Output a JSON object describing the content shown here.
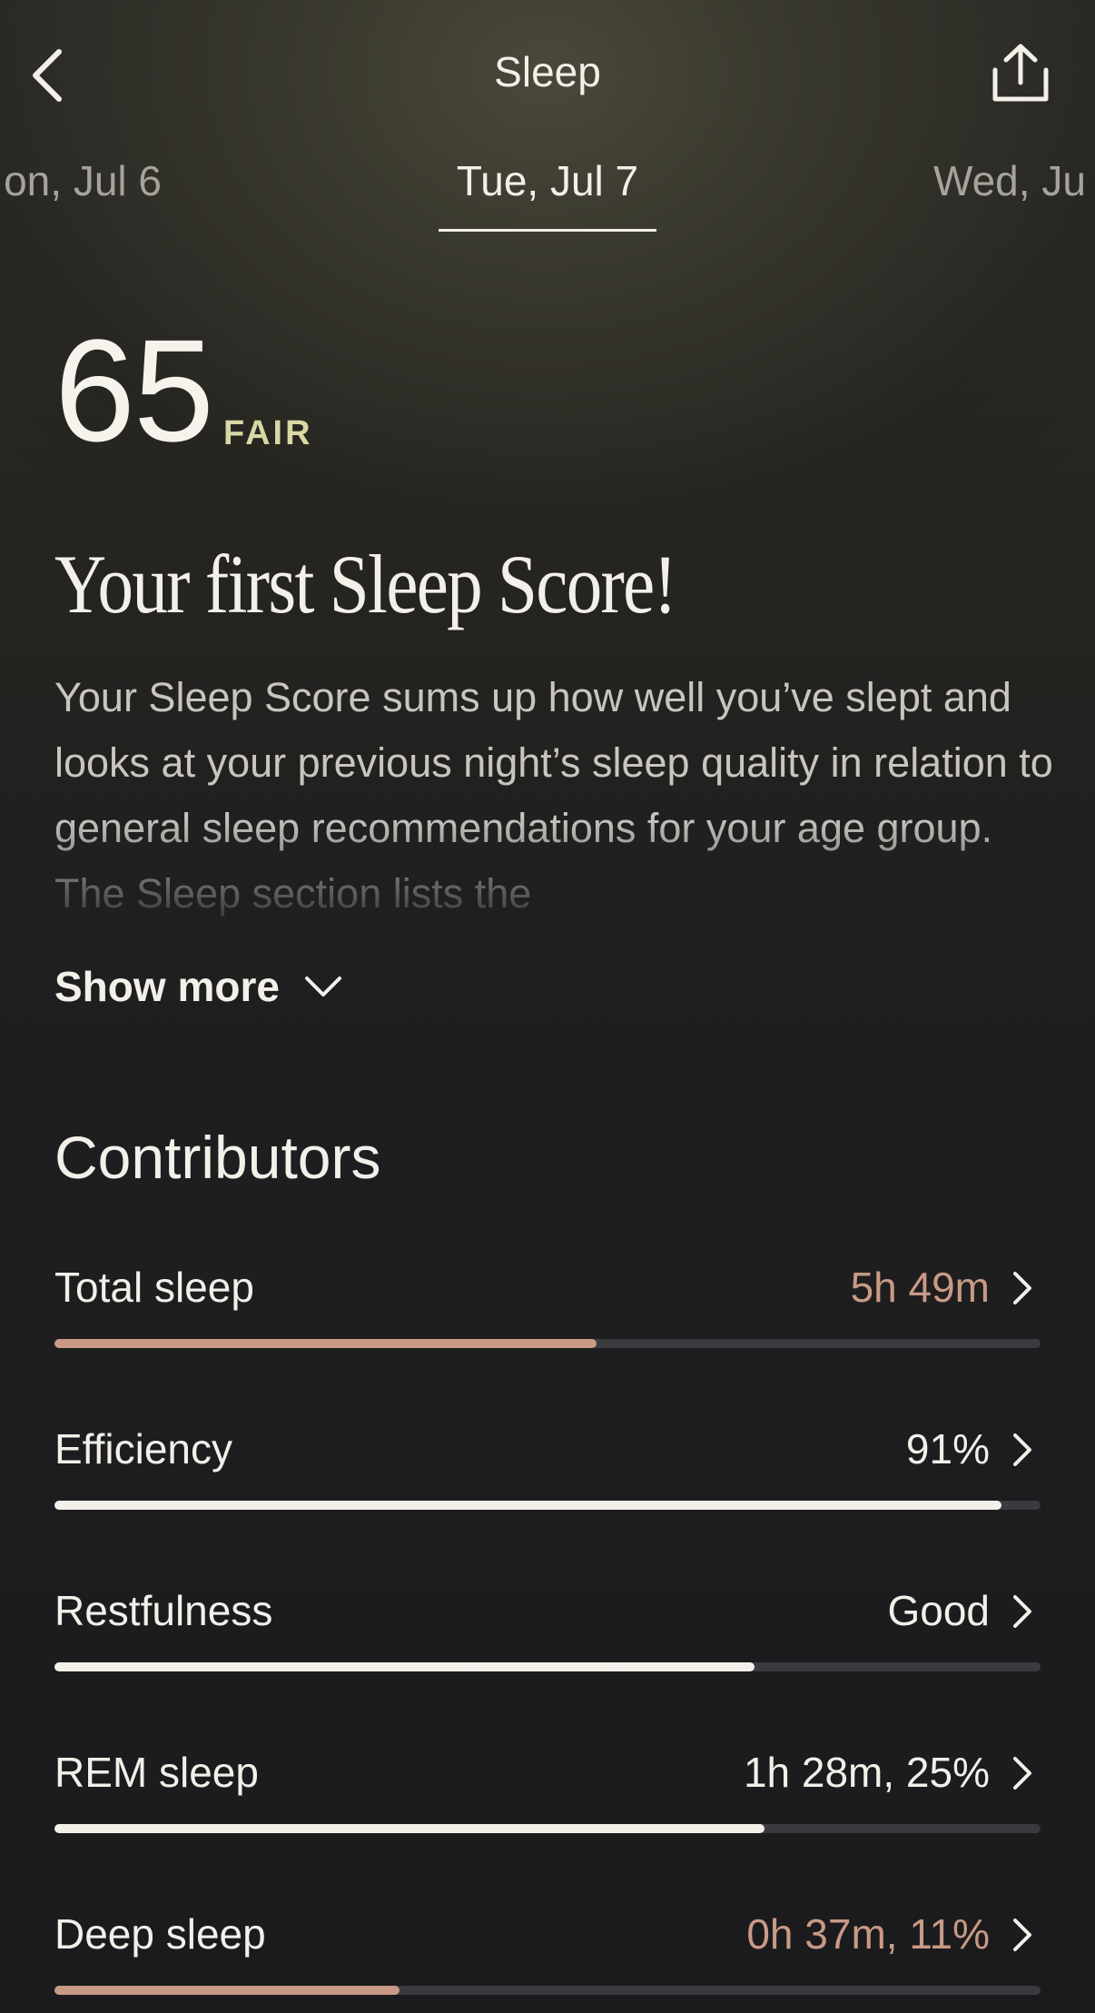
{
  "header": {
    "title": "Sleep"
  },
  "date_tabs": {
    "previous": "on, Jul 6",
    "current": "Tue, Jul 7",
    "next": "Wed, Ju"
  },
  "score": {
    "value": "65",
    "label": "FAIR",
    "label_color": "#d9d7a4"
  },
  "headline": "Your first Sleep Score!",
  "description": "Your Sleep Score sums up how well you’ve slept and looks at your previous night’s sleep quality in relation to general sleep recommendations for your age group. The Sleep section lists the",
  "show_more_label": "Show more",
  "contributors": {
    "heading": "Contributors",
    "items": [
      {
        "name": "Total sleep",
        "value": "5h 49m",
        "level": 0.55,
        "status": "attention",
        "color": "#c99a85"
      },
      {
        "name": "Efficiency",
        "value": "91%",
        "level": 0.96,
        "status": "normal",
        "color": "#f3efe9"
      },
      {
        "name": "Restfulness",
        "value": "Good",
        "level": 0.71,
        "status": "normal",
        "color": "#f3efe9"
      },
      {
        "name": "REM sleep",
        "value": "1h 28m, 25%",
        "level": 0.72,
        "status": "normal",
        "color": "#f3efe9"
      },
      {
        "name": "Deep sleep",
        "value": "0h 37m, 11%",
        "level": 0.35,
        "status": "attention",
        "color": "#c99a85"
      }
    ]
  },
  "icons": {
    "back": "chevron-left-icon",
    "share": "share-icon",
    "show_more": "chevron-down-icon",
    "row": "chevron-right-icon"
  }
}
